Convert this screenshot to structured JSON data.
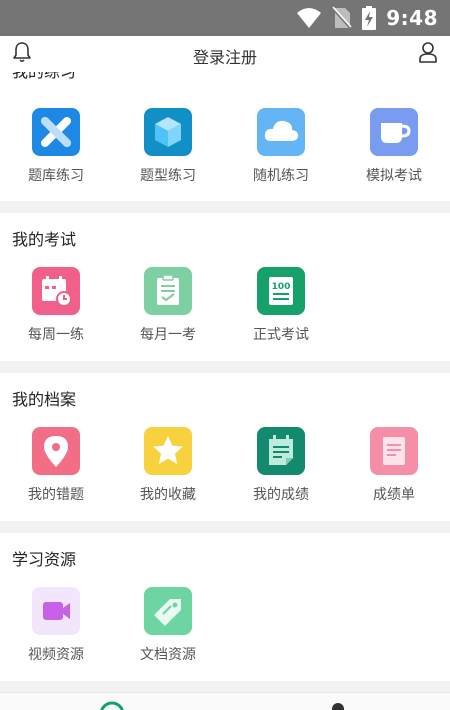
{
  "status_bar": {
    "time": "9:48"
  },
  "header": {
    "title": "登录注册"
  },
  "sections": [
    {
      "title": "我的练习",
      "items": [
        {
          "label": "题库练习",
          "icon": "question-bank-icon",
          "color": "#1E88E5"
        },
        {
          "label": "题型练习",
          "icon": "cube-icon",
          "color": "#1190C8"
        },
        {
          "label": "随机练习",
          "icon": "cloud-icon",
          "color": "#64B5F6"
        },
        {
          "label": "模拟考试",
          "icon": "cup-icon",
          "color": "#7A9CF0"
        }
      ]
    },
    {
      "title": "我的考试",
      "items": [
        {
          "label": "每周一练",
          "icon": "calendar-clock-icon",
          "color": "#F0608A"
        },
        {
          "label": "每月一考",
          "icon": "clipboard-check-icon",
          "color": "#7ED0A2"
        },
        {
          "label": "正式考试",
          "icon": "score-100-icon",
          "color": "#16A06A"
        }
      ]
    },
    {
      "title": "我的档案",
      "items": [
        {
          "label": "我的错题",
          "icon": "map-pin-icon",
          "color": "#F26E87"
        },
        {
          "label": "我的收藏",
          "icon": "star-icon",
          "color": "#F7D23E"
        },
        {
          "label": "我的成绩",
          "icon": "notepad-icon",
          "color": "#138A6E"
        },
        {
          "label": "成绩单",
          "icon": "document-icon",
          "color": "#F58FA8"
        }
      ]
    },
    {
      "title": "学习资源",
      "items": [
        {
          "label": "视频资源",
          "icon": "video-camera-icon",
          "color": "#F1E6FB"
        },
        {
          "label": "文档资源",
          "icon": "tag-icon",
          "color": "#6DD5A1"
        }
      ]
    }
  ]
}
